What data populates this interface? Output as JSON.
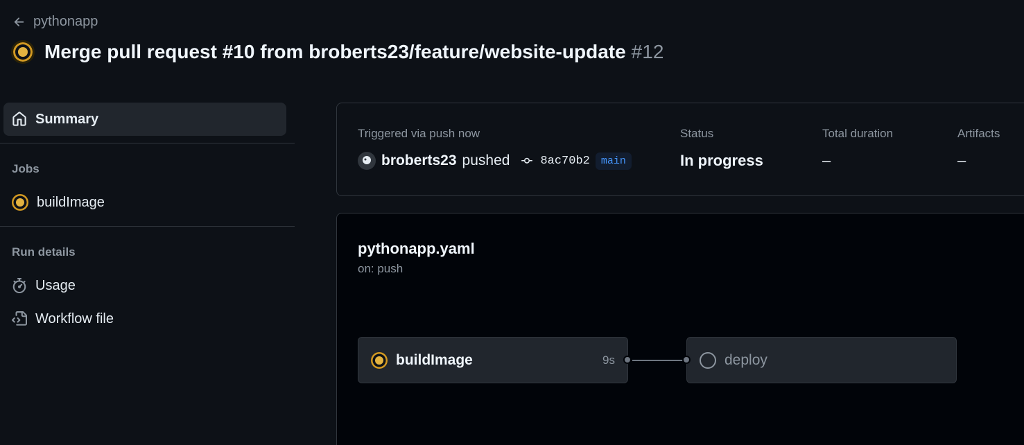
{
  "header": {
    "back_label": "pythonapp",
    "title": "Merge pull request #10 from broberts23/feature/website-update",
    "run_number": "#12"
  },
  "sidebar": {
    "summary_label": "Summary",
    "jobs_heading": "Jobs",
    "jobs": [
      {
        "label": "buildImage",
        "status": "in_progress"
      }
    ],
    "run_details_heading": "Run details",
    "run_details": [
      {
        "label": "Usage",
        "icon": "stopwatch-icon"
      },
      {
        "label": "Workflow file",
        "icon": "file-code-icon"
      }
    ]
  },
  "summary": {
    "trigger_label": "Triggered via push now",
    "actor": "broberts23",
    "action": "pushed",
    "commit_sha": "8ac70b2",
    "branch": "main",
    "status_label": "Status",
    "status_value": "In progress",
    "duration_label": "Total duration",
    "duration_value": "–",
    "artifacts_label": "Artifacts",
    "artifacts_value": "–"
  },
  "workflow": {
    "file_name": "pythonapp.yaml",
    "trigger": "on: push",
    "jobs": [
      {
        "name": "buildImage",
        "status": "in_progress",
        "duration": "9s"
      },
      {
        "name": "deploy",
        "status": "pending",
        "duration": ""
      }
    ]
  },
  "colors": {
    "background": "#0d1117",
    "panel": "#21262d",
    "border": "#30363d",
    "in_progress": "#d29922",
    "branch_text": "#4493f8"
  }
}
